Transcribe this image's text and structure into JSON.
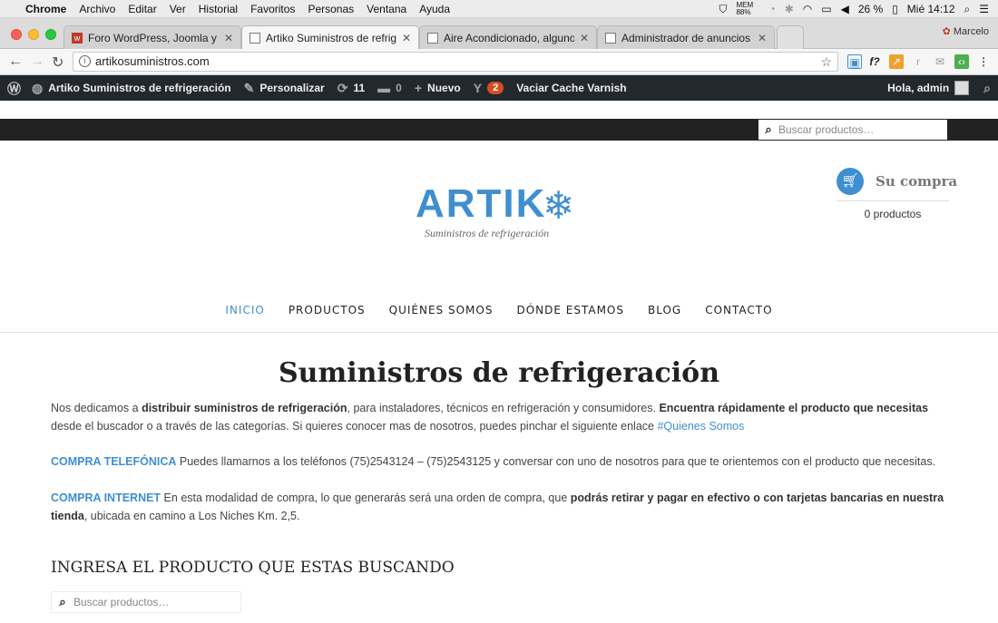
{
  "menubar": {
    "apple": "",
    "items": [
      "Chrome",
      "Archivo",
      "Editar",
      "Ver",
      "Historial",
      "Favoritos",
      "Personas",
      "Ventana",
      "Ayuda"
    ],
    "mem": "MEM 88%",
    "battery": "26 %",
    "clock": "Mié 14:12"
  },
  "tabs": [
    {
      "title": "Foro WordPress, Joomla y Pre"
    },
    {
      "title": "Artiko Suministros de refrigera"
    },
    {
      "title": "Aire Acondicionado, algunos ti"
    },
    {
      "title": "Administrador de anuncios"
    }
  ],
  "profile": "Marcelo",
  "address": {
    "url": "artikosuministros.com"
  },
  "wpadmin": {
    "site": "Artiko Suministros de refrigeración",
    "customize": "Personalizar",
    "updates": "11",
    "comments": "0",
    "new": "Nuevo",
    "yoast_count": "2",
    "varnish": "Vaciar Cache Varnish",
    "greeting": "Hola, admin"
  },
  "search": {
    "placeholder": "Buscar productos…"
  },
  "logo": {
    "word": "ARTIK",
    "tagline": "Suministros de refrigeración"
  },
  "cart": {
    "label": "Su compra",
    "count": "0 productos"
  },
  "nav": [
    "INICIO",
    "PRODUCTOS",
    "QUIÉNES SOMOS",
    "DÓNDE ESTAMOS",
    "BLOG",
    "CONTACTO"
  ],
  "content": {
    "title": "Suministros de refrigeración",
    "p1_a": "Nos dedicamos a ",
    "p1_b": "distribuir suministros de refrigeración",
    "p1_c": ", para instaladores, técnicos en refrigeración y consumidores. ",
    "p1_d": "Encuentra rápidamente el producto que necesitas",
    "p1_e": " desde el buscador o a través de las categorías. Si quieres conocer mas de nosotros, puedes pinchar el siguiente enlace ",
    "p1_link": "#Quienes Somos",
    "p2_label": "COMPRA TELEFÓNICA",
    "p2_text": " Puedes llamarnos a los teléfonos (75)2543124 – (75)2543125 y conversar con uno de nosotros para que te orientemos con el producto que necesitas.",
    "p3_label": "COMPRA INTERNET",
    "p3_a": " En esta modalidad de compra, lo que generarás será una orden de compra, que ",
    "p3_b": "podrás retirar y pagar en efectivo o con tarjetas bancarias en nuestra tienda",
    "p3_c": ", ubicada en camino a Los Niches Km. 2,5.",
    "subheading": "INGRESA EL PRODUCTO QUE ESTAS BUSCANDO"
  },
  "colors": {
    "accent": "#3f8fd0",
    "wpbar": "#23282d",
    "badge": "#d54e21"
  }
}
